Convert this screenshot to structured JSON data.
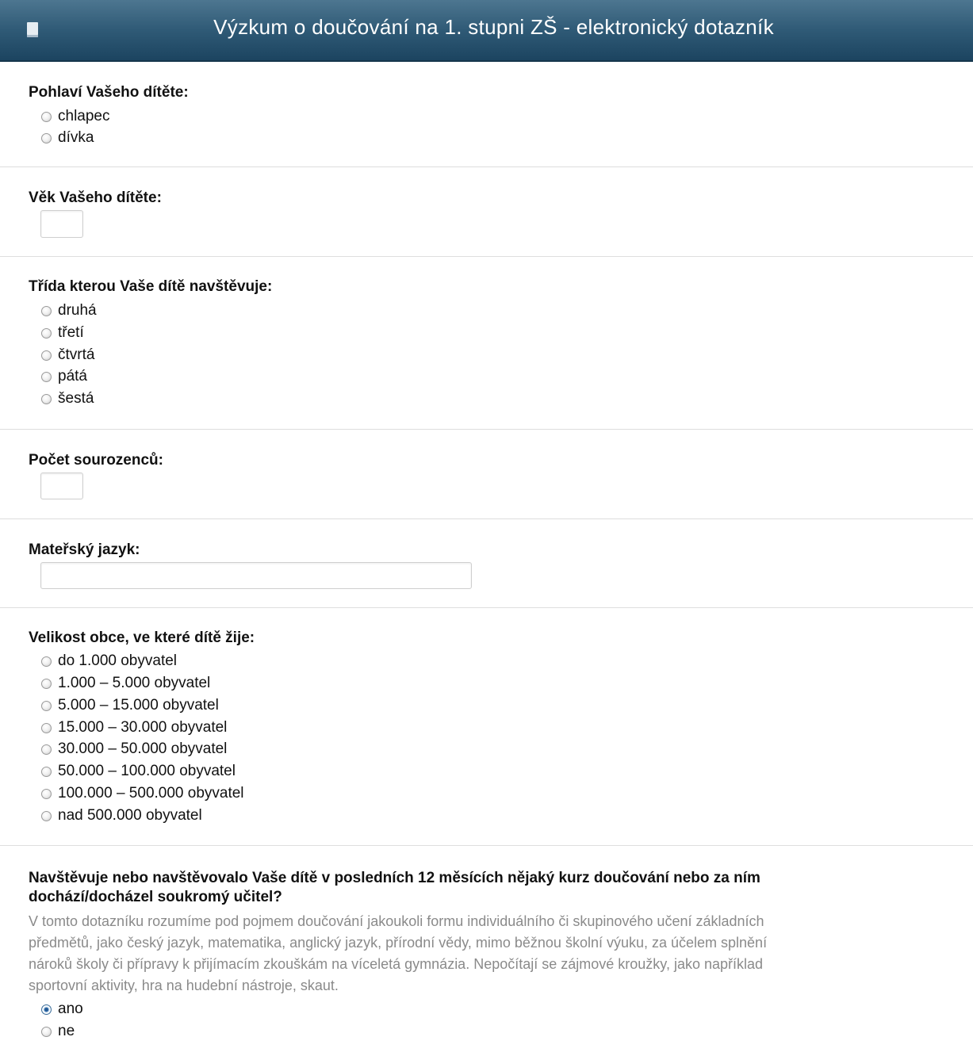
{
  "header": {
    "title": "Výzkum o doučování na 1. stupni ZŠ - elektronický dotazník",
    "icon": "book-icon"
  },
  "questions": {
    "gender": {
      "label": "Pohlaví Vašeho dítěte:",
      "options": [
        "chlapec",
        "dívka"
      ]
    },
    "age": {
      "label": "Věk Vašeho dítěte:",
      "value": ""
    },
    "grade": {
      "label": "Třída kterou Vaše dítě navštěvuje:",
      "options": [
        "druhá",
        "třetí",
        "čtvrtá",
        "pátá",
        "šestá"
      ]
    },
    "siblings": {
      "label": "Počet sourozenců:",
      "value": ""
    },
    "language": {
      "label": "Mateřský jazyk:",
      "value": ""
    },
    "town_size": {
      "label": "Velikost obce, ve které dítě žije:",
      "options": [
        "do 1.000 obyvatel",
        "1.000 – 5.000 obyvatel",
        "5.000 – 15.000 obyvatel",
        "15.000 – 30.000 obyvatel",
        "30.000 – 50.000 obyvatel",
        "50.000 – 100.000 obyvatel",
        "100.000 – 500.000 obyvatel",
        "nad 500.000 obyvatel"
      ]
    },
    "tutoring": {
      "label_line1": "Navštěvuje nebo navštěvovalo Vaše dítě v posledních 12 měsících nějaký kurz doučování nebo za ním",
      "label_line2": "dochází/docházel soukromý učitel?",
      "desc_lines": [
        "V tomto dotazníku rozumíme pod pojmem doučování jakoukoli formu individuálního či skupinového učení základních",
        "předmětů, jako český jazyk, matematika, anglický jazyk, přírodní vědy, mimo běžnou školní výuku, za účelem splnění",
        "nároků školy či přípravy k přijímacím zkouškám na víceletá gymnázia. Nepočítají se zájmové kroužky, jako například",
        "sportovní aktivity, hra na hudební nástroje, skaut."
      ],
      "options": [
        "ano",
        "ne"
      ],
      "selected": "ano"
    }
  }
}
